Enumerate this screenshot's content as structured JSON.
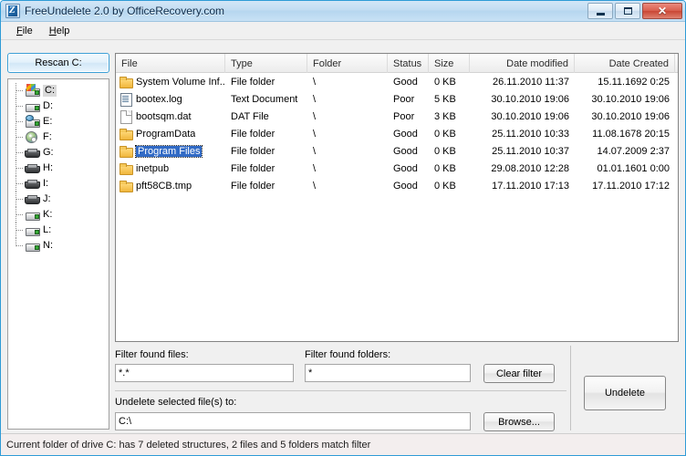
{
  "window": {
    "title": "FreeUndelete 2.0 by OfficeRecovery.com",
    "app_icon": "app-icon",
    "buttons": {
      "minimize": "minimize-icon",
      "maximize": "maximize-icon",
      "close": "✕"
    }
  },
  "menubar": {
    "items": [
      {
        "pre": "",
        "accel": "F",
        "post": "ile"
      },
      {
        "pre": "",
        "accel": "H",
        "post": "elp"
      }
    ]
  },
  "sidebar": {
    "rescan_label": "Rescan C:",
    "drives": [
      {
        "label": "C:",
        "icon": "system-drive-icon",
        "selected": true
      },
      {
        "label": "D:",
        "icon": "hard-drive-icon",
        "selected": false
      },
      {
        "label": "E:",
        "icon": "network-drive-icon",
        "selected": false
      },
      {
        "label": "F:",
        "icon": "cd-drive-icon",
        "selected": false
      },
      {
        "label": "G:",
        "icon": "removable-drive-icon",
        "selected": false
      },
      {
        "label": "H:",
        "icon": "removable-drive-icon",
        "selected": false
      },
      {
        "label": "I:",
        "icon": "removable-drive-icon",
        "selected": false
      },
      {
        "label": "J:",
        "icon": "removable-drive-icon",
        "selected": false
      },
      {
        "label": "K:",
        "icon": "hard-drive-icon",
        "selected": false
      },
      {
        "label": "L:",
        "icon": "hard-drive-icon",
        "selected": false
      },
      {
        "label": "N:",
        "icon": "hard-drive-icon",
        "selected": false
      }
    ]
  },
  "filelist": {
    "columns": [
      {
        "label": "File",
        "align": "left"
      },
      {
        "label": "Type",
        "align": "left"
      },
      {
        "label": "Folder",
        "align": "left"
      },
      {
        "label": "Status",
        "align": "left"
      },
      {
        "label": "Size",
        "align": "left"
      },
      {
        "label": "Date modified",
        "align": "right"
      },
      {
        "label": "Date Created",
        "align": "right"
      }
    ],
    "rows": [
      {
        "icon": "folder-icon",
        "name": "System Volume Inf...",
        "type": "File folder",
        "folder": "\\",
        "status": "Good",
        "size": "0 KB",
        "modified": "26.11.2010 11:37",
        "created": "15.11.1692  0:25",
        "selected": false
      },
      {
        "icon": "text-document-icon",
        "name": "bootex.log",
        "type": "Text Document",
        "folder": "\\",
        "status": "Poor",
        "size": "5 KB",
        "modified": "30.10.2010 19:06",
        "created": "30.10.2010 19:06",
        "selected": false
      },
      {
        "icon": "dat-file-icon",
        "name": "bootsqm.dat",
        "type": "DAT File",
        "folder": "\\",
        "status": "Poor",
        "size": "3 KB",
        "modified": "30.10.2010 19:06",
        "created": "30.10.2010 19:06",
        "selected": false
      },
      {
        "icon": "folder-icon",
        "name": "ProgramData",
        "type": "File folder",
        "folder": "\\",
        "status": "Good",
        "size": "0 KB",
        "modified": "25.11.2010 10:33",
        "created": "11.08.1678 20:15",
        "selected": false
      },
      {
        "icon": "folder-icon",
        "name": "Program Files",
        "type": "File folder",
        "folder": "\\",
        "status": "Good",
        "size": "0 KB",
        "modified": "25.11.2010 10:37",
        "created": "14.07.2009  2:37",
        "selected": true
      },
      {
        "icon": "folder-icon",
        "name": "inetpub",
        "type": "File folder",
        "folder": "\\",
        "status": "Good",
        "size": "0 KB",
        "modified": "29.08.2010 12:28",
        "created": "01.01.1601  0:00",
        "selected": false
      },
      {
        "icon": "folder-icon",
        "name": "pft58CB.tmp",
        "type": "File folder",
        "folder": "\\",
        "status": "Good",
        "size": "0 KB",
        "modified": "17.11.2010 17:13",
        "created": "17.11.2010 17:12",
        "selected": false
      }
    ]
  },
  "filters": {
    "files_label": "Filter found files:",
    "files_value": "*.*",
    "folders_label": "Filter found folders:",
    "folders_value": "*",
    "clear_label": "Clear filter"
  },
  "destination": {
    "label": "Undelete selected file(s) to:",
    "value": "C:\\",
    "browse_label": "Browse..."
  },
  "actions": {
    "undelete_label": "Undelete"
  },
  "statusbar": {
    "text": "Current folder of drive C: has 7 deleted structures, 2 files and 5 folders match filter"
  },
  "colors": {
    "title_bar": "#c2ddf2",
    "window_border": "#2e9bd6",
    "selection": "#316ac5",
    "close_button": "#c94634",
    "focus_border": "#3c9fd6"
  }
}
